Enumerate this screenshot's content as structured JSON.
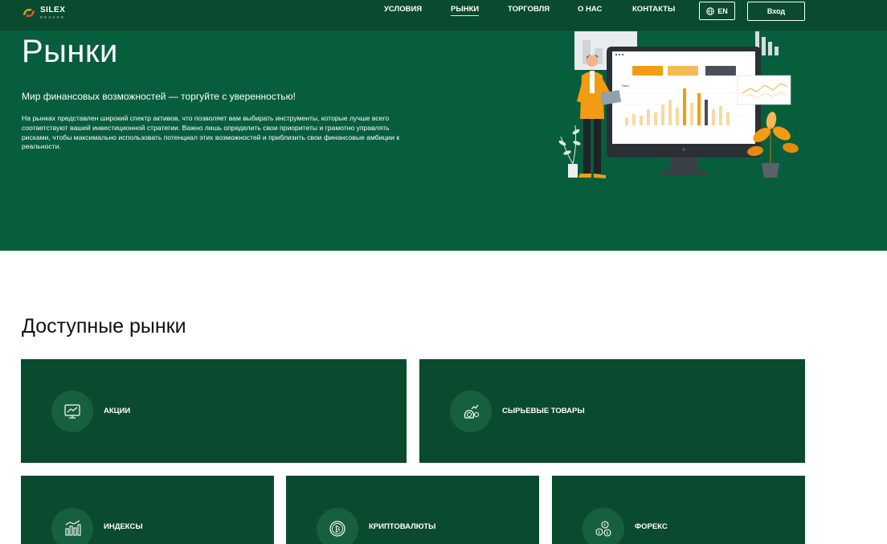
{
  "brand": {
    "name": "SILEX",
    "sub": "BROKER"
  },
  "nav": [
    {
      "label": "УСЛОВИЯ",
      "active": false
    },
    {
      "label": "РЫНКИ",
      "active": true
    },
    {
      "label": "ТОРГОВЛЯ",
      "active": false
    },
    {
      "label": "О НАС",
      "active": false
    },
    {
      "label": "КОНТАКТЫ",
      "active": false
    }
  ],
  "language": {
    "label": "EN",
    "icon": "globe-icon"
  },
  "login": {
    "label": "Вход"
  },
  "hero": {
    "title": "Рынки",
    "subtitle": "Мир финансовых возможностей — торгуйте с уверенностью!",
    "description": "На рынках представлен широкий спектр активов, что позволяет вам выбирать инструменты, которые лучше всего соответствуют вашей инвестиционной стратегии. Важно лишь определить свои приоритеты и грамотно управлять рисками, чтобы максимально использовать потенциал этих возможностей и приблизить свои финансовые амбиции к реальности.",
    "illustration": {
      "monitor_label": "Sales"
    }
  },
  "markets": {
    "title": "Доступные рынки",
    "items": [
      {
        "label": "АКЦИИ",
        "icon": "stock-chart-icon"
      },
      {
        "label": "СЫРЬЕВЫЕ ТОВАРЫ",
        "icon": "commodities-icon"
      },
      {
        "label": "ИНДЕКСЫ",
        "icon": "index-bars-icon"
      },
      {
        "label": "КРИПТОВАЛЮТЫ",
        "icon": "bitcoin-icon"
      },
      {
        "label": "ФОРЕКС",
        "icon": "currency-exchange-icon"
      }
    ]
  },
  "colors": {
    "header": "#0a4a2e",
    "hero": "#075e3d",
    "card": "#0a4a2e",
    "accent": "#f39c12"
  }
}
